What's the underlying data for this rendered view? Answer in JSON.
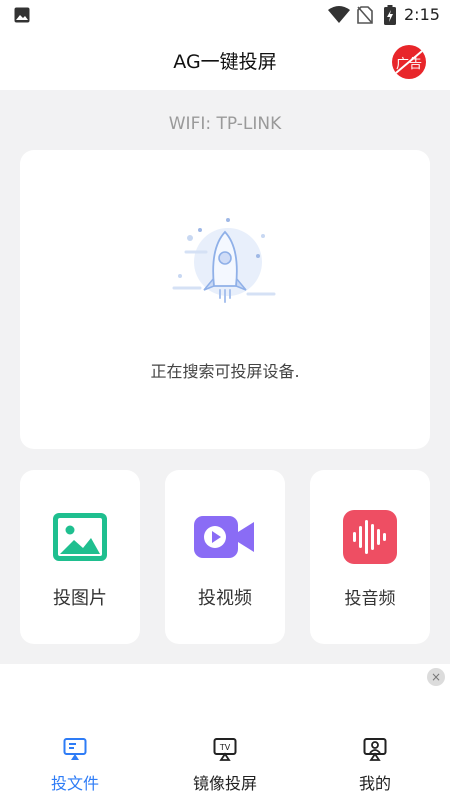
{
  "status_bar": {
    "time": "2:15",
    "icons": [
      "gallery-icon",
      "wifi-icon",
      "sim-off-icon",
      "battery-charging-icon"
    ]
  },
  "header": {
    "title": "AG一键投屏",
    "ad_badge": "广告"
  },
  "wifi": {
    "label": "WIFI: TP-LINK"
  },
  "search": {
    "status": "正在搜索可投屏设备.",
    "illustration": "rocket-icon"
  },
  "features": [
    {
      "label": "投图片",
      "icon": "image-icon",
      "color": "#1fbf8f"
    },
    {
      "label": "投视频",
      "icon": "video-icon",
      "color": "#8a6cf5"
    },
    {
      "label": "投音频",
      "icon": "audio-icon",
      "color": "#ee4e63"
    }
  ],
  "ad": {
    "close": "×"
  },
  "bottom_nav": {
    "active_index": 0,
    "active_color": "#2e7cf6",
    "items": [
      {
        "label": "投文件",
        "icon": "file-cast-icon"
      },
      {
        "label": "镜像投屏",
        "icon": "tv-icon"
      },
      {
        "label": "我的",
        "icon": "profile-icon"
      }
    ]
  }
}
